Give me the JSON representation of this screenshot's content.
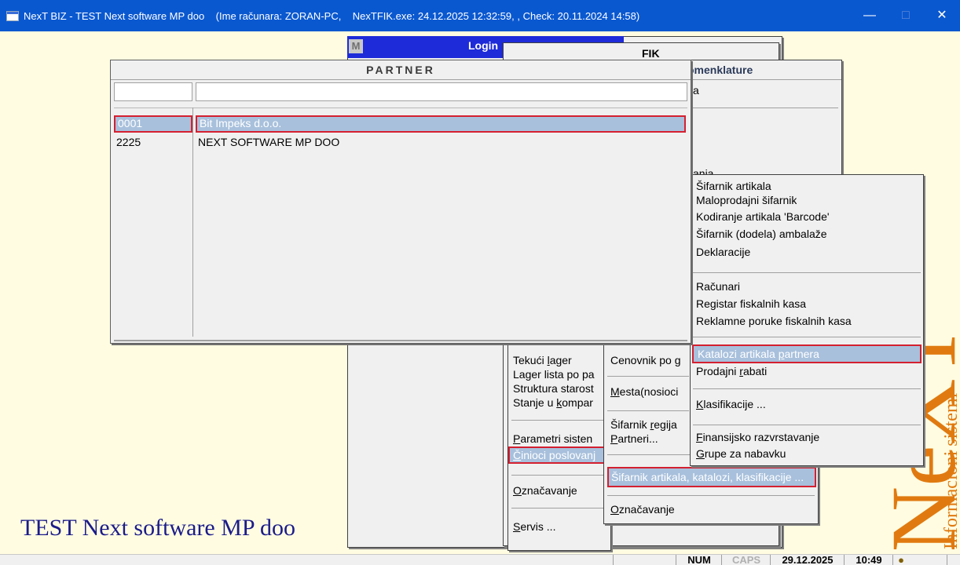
{
  "titlebar": {
    "text": "NexT BIZ - TEST Next software MP doo    (Ime računara: ZORAN-PC,    NexTFIK.exe: 24.12.2025 12:32:59, , Check: 20.11.2024 14:58)",
    "minimize": "—",
    "maximize": "□",
    "close": "✕"
  },
  "login": {
    "m_label": "M",
    "title": "Login"
  },
  "fik": {
    "title": "FIK"
  },
  "nomenklature": {
    "title": "omenklature",
    "item1": "ka",
    "item2": "ćanja"
  },
  "partner": {
    "title": "PARTNER",
    "code_filter": "",
    "name_filter": "",
    "rows": [
      {
        "code": "0001",
        "name": "Bit Impeks d.o.o."
      },
      {
        "code": "2225",
        "name": "NEXT SOFTWARE MP DOO"
      }
    ]
  },
  "submenu_articles": {
    "items": [
      "Šifarnik artikala",
      "Maloprodajni šifarnik",
      "Kodiranje artikala 'Barcode'",
      "Šifarnik (dodela) ambalaže",
      "Deklaracije",
      "Računari",
      "Registar fiskalnih kasa",
      "Reklamne poruke fiskalnih kasa",
      "Katalozi artikala partnera",
      "Prodajni rabati",
      "Klasifikacije ...",
      "Finansijsko razvrstavanje",
      "Grupe za nabavku"
    ]
  },
  "submenu_factors": {
    "items": [
      "Cenovnik po g",
      "Mesta(nosioci",
      "Šifarnik regija",
      "Partneri...",
      "Šifarnik artikala, katalozi, klasifikacije ...",
      "Označavanje"
    ]
  },
  "main_menu": {
    "items": [
      "Tekući lager",
      "Lager lista po pa",
      "Struktura starost",
      "Stanje u kompar",
      "Parametri sisten",
      "Činioci poslovanj",
      "Označavanje",
      "Servis ..."
    ]
  },
  "company_name": "TEST Next software MP doo",
  "logo": {
    "letters": "NeXT",
    "subtitle": "Informacioni sistemi"
  },
  "statusbar": {
    "num": "NUM",
    "caps": "CAPS",
    "date": "29.12.2025",
    "time": "10:49"
  },
  "colors": {
    "titlebar": "#0a58d0",
    "background": "#fffce1",
    "selection": "#a8c0dc",
    "selection_border": "#d42030",
    "company_text": "#1b1b8a",
    "logo": "#e07a10"
  }
}
